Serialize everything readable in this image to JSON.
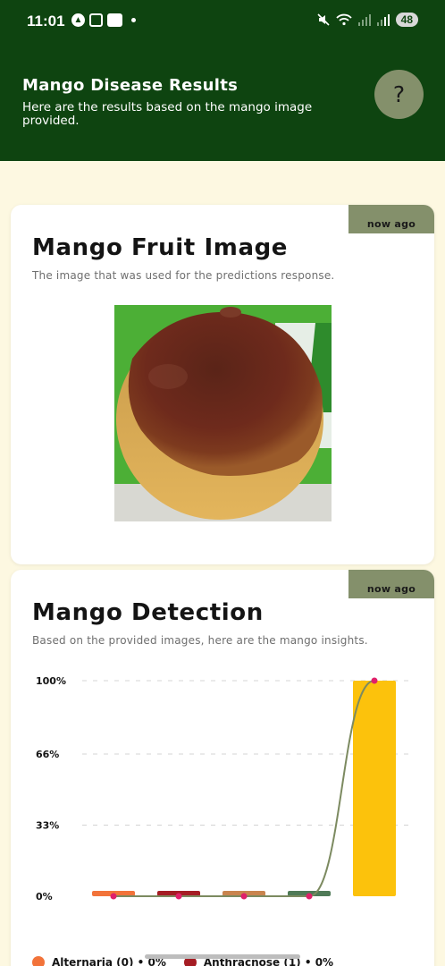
{
  "status_bar": {
    "time": "11:01",
    "battery": "48",
    "icons": [
      "a-icon",
      "screen-record-icon",
      "teams-icon",
      "dot-icon",
      "mute-icon",
      "wifi-icon",
      "signal-icon"
    ]
  },
  "header": {
    "title": "Mango Disease Results",
    "subtitle": "Here are the results based on the mango image provided.",
    "help_label": "?",
    "background": "#0e4410"
  },
  "image_card": {
    "badge": "now ago",
    "title": "Mango Fruit Image",
    "subtitle": "The image that was used for the predictions response."
  },
  "detection_card": {
    "badge": "now ago",
    "title": "Mango Detection",
    "subtitle": "Based on the provided images, here are the mango insights."
  },
  "chart_data": {
    "type": "bar",
    "categories": [
      "Alternaria",
      "Anthracnose",
      "",
      "",
      ""
    ],
    "values": [
      0,
      0,
      0,
      0,
      100
    ],
    "colors": [
      "#f2733a",
      "#a51d24",
      "#c9844e",
      "#4f7a57",
      "#fcc20c"
    ],
    "ytick_labels": [
      "100%",
      "66%",
      "33%",
      "0%"
    ],
    "yticks": [
      100,
      66,
      33,
      0
    ],
    "ylim": [
      0,
      100
    ],
    "grid": true,
    "line_overlay": true,
    "line_color": "#7c8a60",
    "point_color": "#e0206a"
  },
  "legend": {
    "items": [
      {
        "label": "Alternaria (0) • 0%",
        "color": "#f2733a"
      },
      {
        "label": "Anthracnose (1) • 0%",
        "color": "#a51d24"
      }
    ]
  }
}
